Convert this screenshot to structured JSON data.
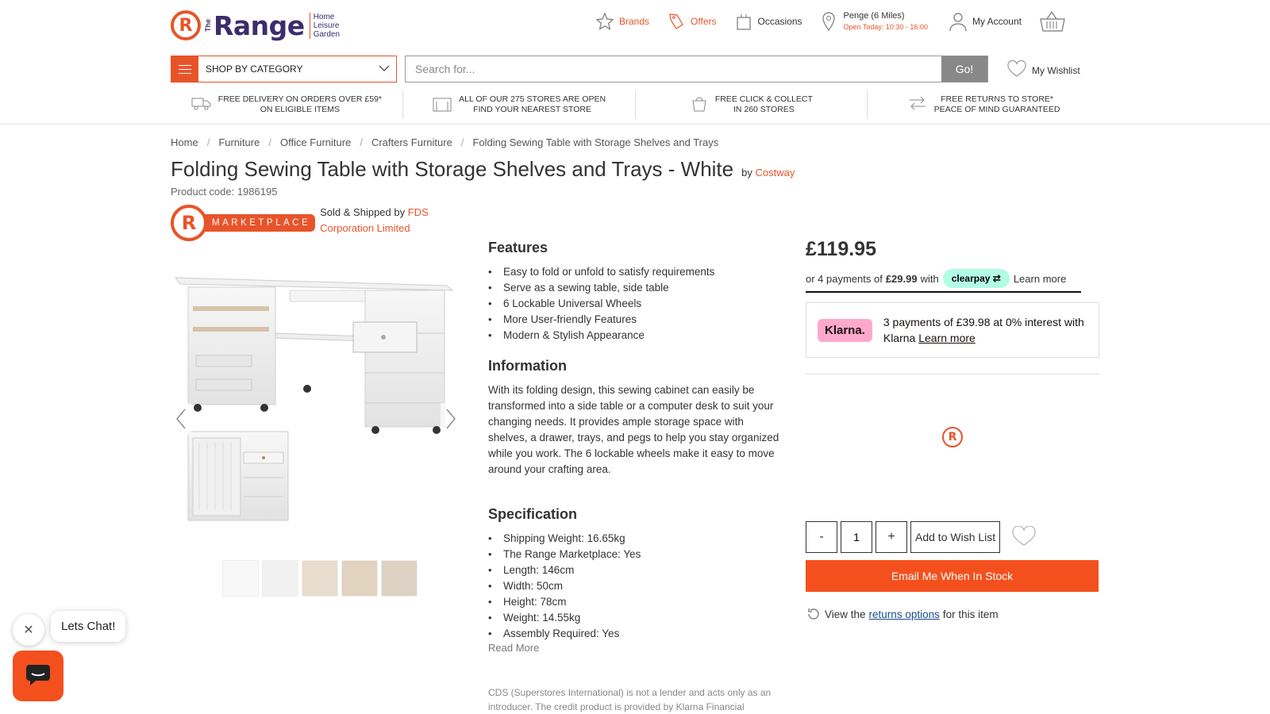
{
  "header": {
    "logo": {
      "mark": "R",
      "the": "The",
      "word": "Range",
      "tagline": [
        "Home",
        "Leisure",
        "Garden"
      ]
    },
    "links": [
      {
        "label": "Brands",
        "icon": "star-icon"
      },
      {
        "label": "Offers",
        "icon": "tag-icon"
      },
      {
        "label": "Occasions",
        "icon": "gift-icon"
      }
    ],
    "store": {
      "name": "Penge (6 Miles)",
      "hours": "Open Today: 10:30 - 16:00"
    },
    "account_label": "My Account",
    "category_label": "SHOP BY CATEGORY",
    "search": {
      "placeholder": "Search for...",
      "go_label": "Go!"
    },
    "wishlist_label": "My Wishlist",
    "usps": [
      {
        "line1": "FREE DELIVERY ON ORDERS OVER £59*",
        "line2": "ON ELIGIBLE ITEMS",
        "icon": "delivery-truck-icon"
      },
      {
        "line1": "ALL OF OUR 275 STORES ARE OPEN",
        "line2": "FIND YOUR NEAREST STORE",
        "icon": "store-icon"
      },
      {
        "line1": "FREE CLICK & COLLECT",
        "line2": "IN 260 STORES",
        "icon": "click-collect-icon"
      },
      {
        "line1": "FREE RETURNS TO STORE*",
        "line2": "PEACE OF MIND GUARANTEED",
        "icon": "returns-arrows-icon"
      }
    ]
  },
  "breadcrumb": [
    "Home",
    "Furniture",
    "Office Furniture",
    "Crafters Furniture",
    "Folding Sewing Table with Storage Shelves and Trays"
  ],
  "product": {
    "title": "Folding Sewing Table with Storage Shelves and Trays - White",
    "by_prefix": "by",
    "brand": "Costway",
    "code": "Product code: 1986195",
    "marketplace_label": "MARKETPLACE",
    "sold_by_prefix": "Sold & Shipped by",
    "seller": "FDS Corporation Limited"
  },
  "features": {
    "heading": "Features",
    "items": [
      "Easy to fold or unfold to satisfy requirements",
      "Serve as a sewing table, side table",
      "6 Lockable Universal Wheels",
      "More User-friendly Features",
      "Modern & Stylish Appearance"
    ]
  },
  "information": {
    "heading": "Information",
    "text": "With its folding design, this sewing cabinet can easily be transformed into a side table or a computer desk to suit your changing needs. It provides ample storage space with shelves, a drawer, trays, and pegs to help you stay organized while you work. The 6 lockable wheels make it easy to move around your crafting area."
  },
  "specification": {
    "heading": "Specification",
    "items": [
      "Shipping Weight: 16.65kg",
      "The Range Marketplace: Yes",
      "Length: 146cm",
      "Width: 50cm",
      "Height: 78cm",
      "Weight: 14.55kg",
      "Assembly Required: Yes"
    ],
    "read_more": "Read More"
  },
  "disclaimer": "CDS (Superstores International) is not a lender and acts only as an introducer. The credit product is provided by Klarna Financial",
  "buybox": {
    "price": "£119.95",
    "clearpay": {
      "prefix": "or 4 payments of",
      "amount": "£29.99",
      "with": "with",
      "badge": "clearpay",
      "learn": "Learn more"
    },
    "klarna": {
      "badge": "Klarna.",
      "text": "3 payments of £39.98 at 0% interest with Klarna",
      "learn": "Learn more"
    },
    "loader_mark": "R",
    "qty": {
      "minus": "-",
      "value": "1",
      "plus": "+"
    },
    "add_wishlist": "Add to Wish List",
    "email_stock": "Email Me When In Stock",
    "returns": {
      "prefix": "View the",
      "link": "returns options",
      "suffix": "for this item"
    }
  },
  "chat": {
    "bubble": "Lets Chat!",
    "close": "✕"
  },
  "colors": {
    "accent": "#e8542a",
    "brand_navy": "#3a2d6c",
    "clearpay": "#b2fce4",
    "klarna": "#ffa8cd"
  }
}
